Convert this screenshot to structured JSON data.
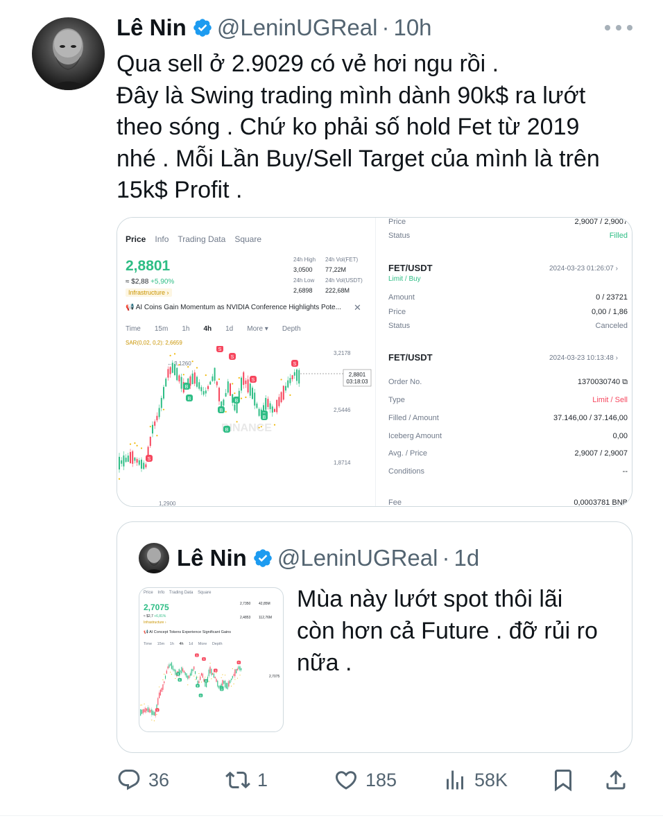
{
  "tweet": {
    "author_name": "Lê Nin",
    "handle": "@LeninUGReal",
    "separator": "·",
    "time": "10h",
    "text_lines": [
      "Qua sell ở 2.9029 có vẻ hơi ngu rồi .",
      "Đây là Swing trading mình dành 90k$ ra lướt",
      "theo sóng . Chứ ko phải số hold Fet từ 2019",
      "nhé . Mỗi Lần Buy/Sell Target của mình là trên",
      "15k$ Profit ."
    ]
  },
  "exchange_screenshot": {
    "tabs": [
      "Price",
      "Info",
      "Trading Data",
      "Square"
    ],
    "price": "2,8801",
    "usd_value": "≈ $2,88",
    "change": "+5,90%",
    "tag": "Infrastructure ›",
    "stats": {
      "high_label": "24h High",
      "high": "3,0500",
      "vol_fet_label": "24h Vol(FET)",
      "vol_fet": "77,22M",
      "low_label": "24h Low",
      "low": "2,6898",
      "vol_usdt_label": "24h Vol(USDT)",
      "vol_usdt": "222,68M"
    },
    "news": "AI Coins Gain Momentum as NVIDIA Conference Highlights Pote...",
    "news_close": "✕",
    "timeframes": [
      "Time",
      "15m",
      "1h",
      "4h",
      "1d",
      "More ▾",
      "Depth"
    ],
    "sar_label": "SAR(0,02, 0,2): 2,6659",
    "chart_labels": {
      "top_right": "3,2178",
      "peak": "3,1260",
      "mid_right": "2,5446",
      "low_right": "1,8714",
      "bottom": "1,2900",
      "current": "2,8801",
      "countdown": "03:18:03",
      "watermark": "BINANCE"
    }
  },
  "order_screenshot": {
    "top": {
      "price_label": "Price",
      "price": "2,9007 / 2,9007",
      "status_label": "Status",
      "status": "Filled"
    },
    "order1": {
      "pair": "FET/USDT",
      "date": "2024-03-23 01:26:07 ›",
      "type": "Limit / Buy",
      "amount_label": "Amount",
      "amount": "0 / 23721",
      "price_label": "Price",
      "price": "0,00 / 1,86",
      "status_label": "Status",
      "status": "Canceled"
    },
    "order2": {
      "pair": "FET/USDT",
      "date": "2024-03-23 10:13:48 ›",
      "order_no_label": "Order No.",
      "order_no": "1370030740 ⧉",
      "type_label": "Type",
      "type": "Limit / Sell",
      "filled_label": "Filled / Amount",
      "filled": "37.146,00 / 37.146,00",
      "iceberg_label": "Iceberg Amount",
      "iceberg": "0,00",
      "avg_label": "Avg. / Price",
      "avg": "2,9007 / 2,9007",
      "conditions_label": "Conditions",
      "conditions": "--",
      "fee_label": "Fee",
      "fee": "0,0003781 BNB"
    }
  },
  "quote": {
    "author_name": "Lê Nin",
    "handle": "@LeninUGReal",
    "separator": "·",
    "time": "1d",
    "text_lines": [
      "Mùa này lướt spot thôi lãi",
      "còn hơn cả Future . đỡ rủi ro",
      "nữa ."
    ],
    "thumb": {
      "tabs": [
        "Price",
        "Info",
        "Trading Data",
        "Square"
      ],
      "price": "2,7075",
      "usd": "≈ $2,7",
      "change": "+6,81%",
      "tag": "Infrastructure ›",
      "high": "2,7350",
      "vol": "42,85M",
      "low": "2,4853",
      "vol2": "112,76M",
      "news": "AI Concept Tokens Experience Significant Gains",
      "timeframes": [
        "Time",
        "15m",
        "1h",
        "4h",
        "1d",
        "More",
        "Depth"
      ],
      "current": "2,7075"
    }
  },
  "actions": {
    "replies": "36",
    "reposts": "1",
    "likes": "185",
    "views": "58K"
  },
  "colors": {
    "text": "#0f1419",
    "secondary": "#536471",
    "verified": "#1d9bf0",
    "up_green": "#2ebd85",
    "down_red": "#f6465d"
  }
}
